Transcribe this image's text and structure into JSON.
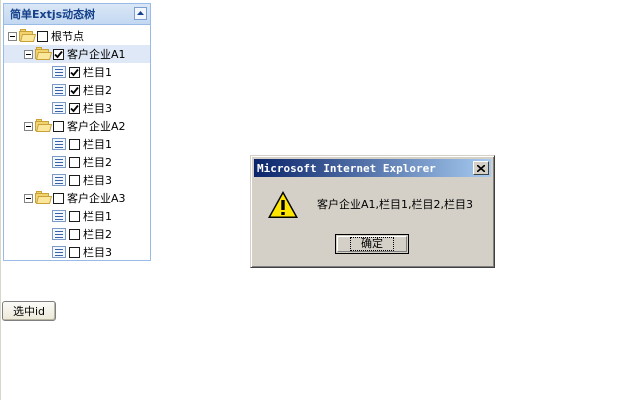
{
  "tree_panel": {
    "title": "简单Extjs动态树",
    "nodes": [
      {
        "label": "根节点",
        "checked": false,
        "type": "folder",
        "level": 0,
        "expanded": true,
        "selected": false
      },
      {
        "label": "客户企业A1",
        "checked": true,
        "type": "folder",
        "level": 1,
        "expanded": true,
        "selected": true
      },
      {
        "label": "栏目1",
        "checked": true,
        "type": "leaf",
        "level": 2,
        "selected": false
      },
      {
        "label": "栏目2",
        "checked": true,
        "type": "leaf",
        "level": 2,
        "selected": false
      },
      {
        "label": "栏目3",
        "checked": true,
        "type": "leaf",
        "level": 2,
        "selected": false
      },
      {
        "label": "客户企业A2",
        "checked": false,
        "type": "folder",
        "level": 1,
        "expanded": true,
        "selected": false
      },
      {
        "label": "栏目1",
        "checked": false,
        "type": "leaf",
        "level": 2,
        "selected": false
      },
      {
        "label": "栏目2",
        "checked": false,
        "type": "leaf",
        "level": 2,
        "selected": false
      },
      {
        "label": "栏目3",
        "checked": false,
        "type": "leaf",
        "level": 2,
        "selected": false
      },
      {
        "label": "客户企业A3",
        "checked": false,
        "type": "folder",
        "level": 1,
        "expanded": true,
        "selected": false
      },
      {
        "label": "栏目1",
        "checked": false,
        "type": "leaf",
        "level": 2,
        "selected": false
      },
      {
        "label": "栏目2",
        "checked": false,
        "type": "leaf",
        "level": 2,
        "selected": false
      },
      {
        "label": "栏目3",
        "checked": false,
        "type": "leaf",
        "level": 2,
        "selected": false
      }
    ]
  },
  "select_button": {
    "label": "选中id"
  },
  "dialog": {
    "title": "Microsoft Internet Explorer",
    "message": "客户企业A1,栏目1,栏目2,栏目3",
    "ok_label": "确定",
    "icon": "warning-icon",
    "close_icon": "close-icon"
  },
  "colors": {
    "titlebar_start": "#0a246a",
    "titlebar_end": "#a6caf0",
    "panel_header_text": "#15428b",
    "panel_border": "#99bbe8",
    "dialog_face": "#d4d0c8"
  }
}
